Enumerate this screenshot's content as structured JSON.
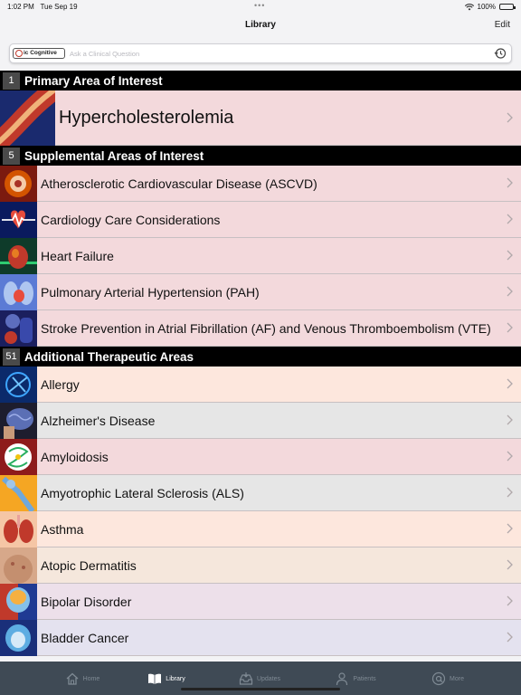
{
  "status": {
    "time": "1:02 PM",
    "date": "Tue Sep 19",
    "battery": "100%"
  },
  "nav": {
    "title": "Library",
    "edit": "Edit"
  },
  "search": {
    "logo": "ic Cognitive",
    "placeholder": "Ask a Clinical Question"
  },
  "sections": {
    "primary": {
      "count": "1",
      "label": "Primary Area of Interest",
      "items": [
        {
          "label": "Hypercholesterolemia",
          "bg": "#f3d9dc"
        }
      ]
    },
    "supplemental": {
      "count": "5",
      "label": "Supplemental Areas of Interest",
      "items": [
        {
          "label": "Atherosclerotic Cardiovascular Disease (ASCVD)",
          "bg": "#f3d9dc"
        },
        {
          "label": "Cardiology Care Considerations",
          "bg": "#f3d9dc"
        },
        {
          "label": "Heart Failure",
          "bg": "#f3d9dc"
        },
        {
          "label": "Pulmonary Arterial Hypertension (PAH)",
          "bg": "#f3d9dc"
        },
        {
          "label": "Stroke Prevention in Atrial Fibrillation (AF) and Venous Thromboembolism (VTE)",
          "bg": "#f3d9dc"
        }
      ]
    },
    "additional": {
      "count": "51",
      "label": "Additional Therapeutic Areas",
      "items": [
        {
          "label": "Allergy",
          "bg": "#fde7dd"
        },
        {
          "label": "Alzheimer's Disease",
          "bg": "#e6e6e6"
        },
        {
          "label": "Amyloidosis",
          "bg": "#f3d9dc"
        },
        {
          "label": "Amyotrophic Lateral Sclerosis (ALS)",
          "bg": "#e6e6e6"
        },
        {
          "label": "Asthma",
          "bg": "#fde7dd"
        },
        {
          "label": "Atopic Dermatitis",
          "bg": "#f5e7dc"
        },
        {
          "label": "Bipolar Disorder",
          "bg": "#ede0ea"
        },
        {
          "label": "Bladder Cancer",
          "bg": "#e4e2ef"
        }
      ]
    }
  },
  "tabs": [
    {
      "label": "Home",
      "icon": "house-icon",
      "active": false
    },
    {
      "label": "Library",
      "icon": "book-icon",
      "active": true
    },
    {
      "label": "Updates",
      "icon": "inbox-icon",
      "active": false
    },
    {
      "label": "Patients",
      "icon": "person-icon",
      "active": false
    },
    {
      "label": "More",
      "icon": "at-icon",
      "active": false
    }
  ]
}
